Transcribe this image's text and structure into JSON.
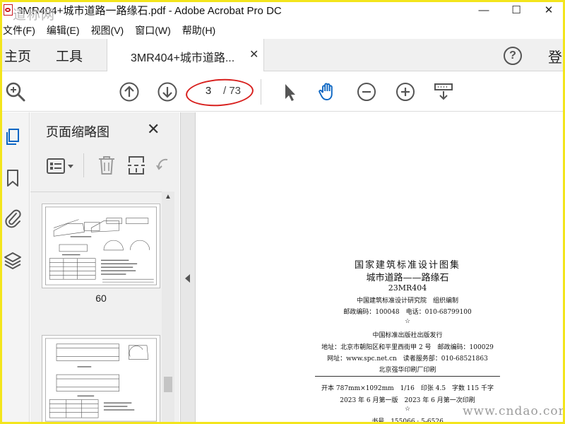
{
  "window": {
    "title": "3MR404+城市道路一路缘石.pdf - Adobe Acrobat Pro DC",
    "watermark_top": "道称网",
    "controls": {
      "minimize": "—",
      "maximize": "☐",
      "close": "✕"
    }
  },
  "menu": [
    "文件(F)",
    "编辑(E)",
    "视图(V)",
    "窗口(W)",
    "帮助(H)"
  ],
  "tabs": {
    "home": "主页",
    "tools": "工具",
    "document": "3MR404+城市道路...",
    "close": "✕",
    "help": "?",
    "signin": "登"
  },
  "toolbar": {
    "current_page": "3",
    "total_pages": "/ 73",
    "icons": [
      "zoom-search-icon",
      "page-up-icon",
      "page-down-icon",
      "select-arrow-icon",
      "hand-icon",
      "zoom-out-icon",
      "zoom-in-icon",
      "scroll-mode-icon"
    ]
  },
  "sidebar": {
    "panel_title": "页面缩略图",
    "close": "✕",
    "icons": [
      "page-thumbnails-icon",
      "bookmark-icon",
      "attachment-icon",
      "layers-icon"
    ],
    "thumbnails": [
      {
        "label": "60"
      },
      {
        "label": ""
      }
    ]
  },
  "cover": {
    "series": "国家建筑标准设计图集",
    "title": "城市道路——路缘石",
    "code": "23MR404",
    "institute": "中国建筑标准设计研究院　组织编制",
    "postal": "邮政编码：100048　电话：010-68799100",
    "star": "☆",
    "publisher": "中国标准出版社出版发行",
    "address": "地址：北京市朝阳区和平里西街甲 2 号　邮政编码：100029",
    "website": "网址：www.spc.net.cn　读者服务部：010-68521863",
    "printer": "北京强华印刷厂印刷",
    "format": "开本 787mm×1092mm　1/16　印张 4.5　字数 115 千字",
    "edition": "2023 年 6 月第一版　2023 年 6 月第一次印刷",
    "isbn": "书号　155066 · 5-6526"
  },
  "watermark_bottom": "www.cndao.com",
  "colors": {
    "accent": "#0b66c3",
    "annotation": "#d8201e",
    "frame": "#f3e51c"
  }
}
